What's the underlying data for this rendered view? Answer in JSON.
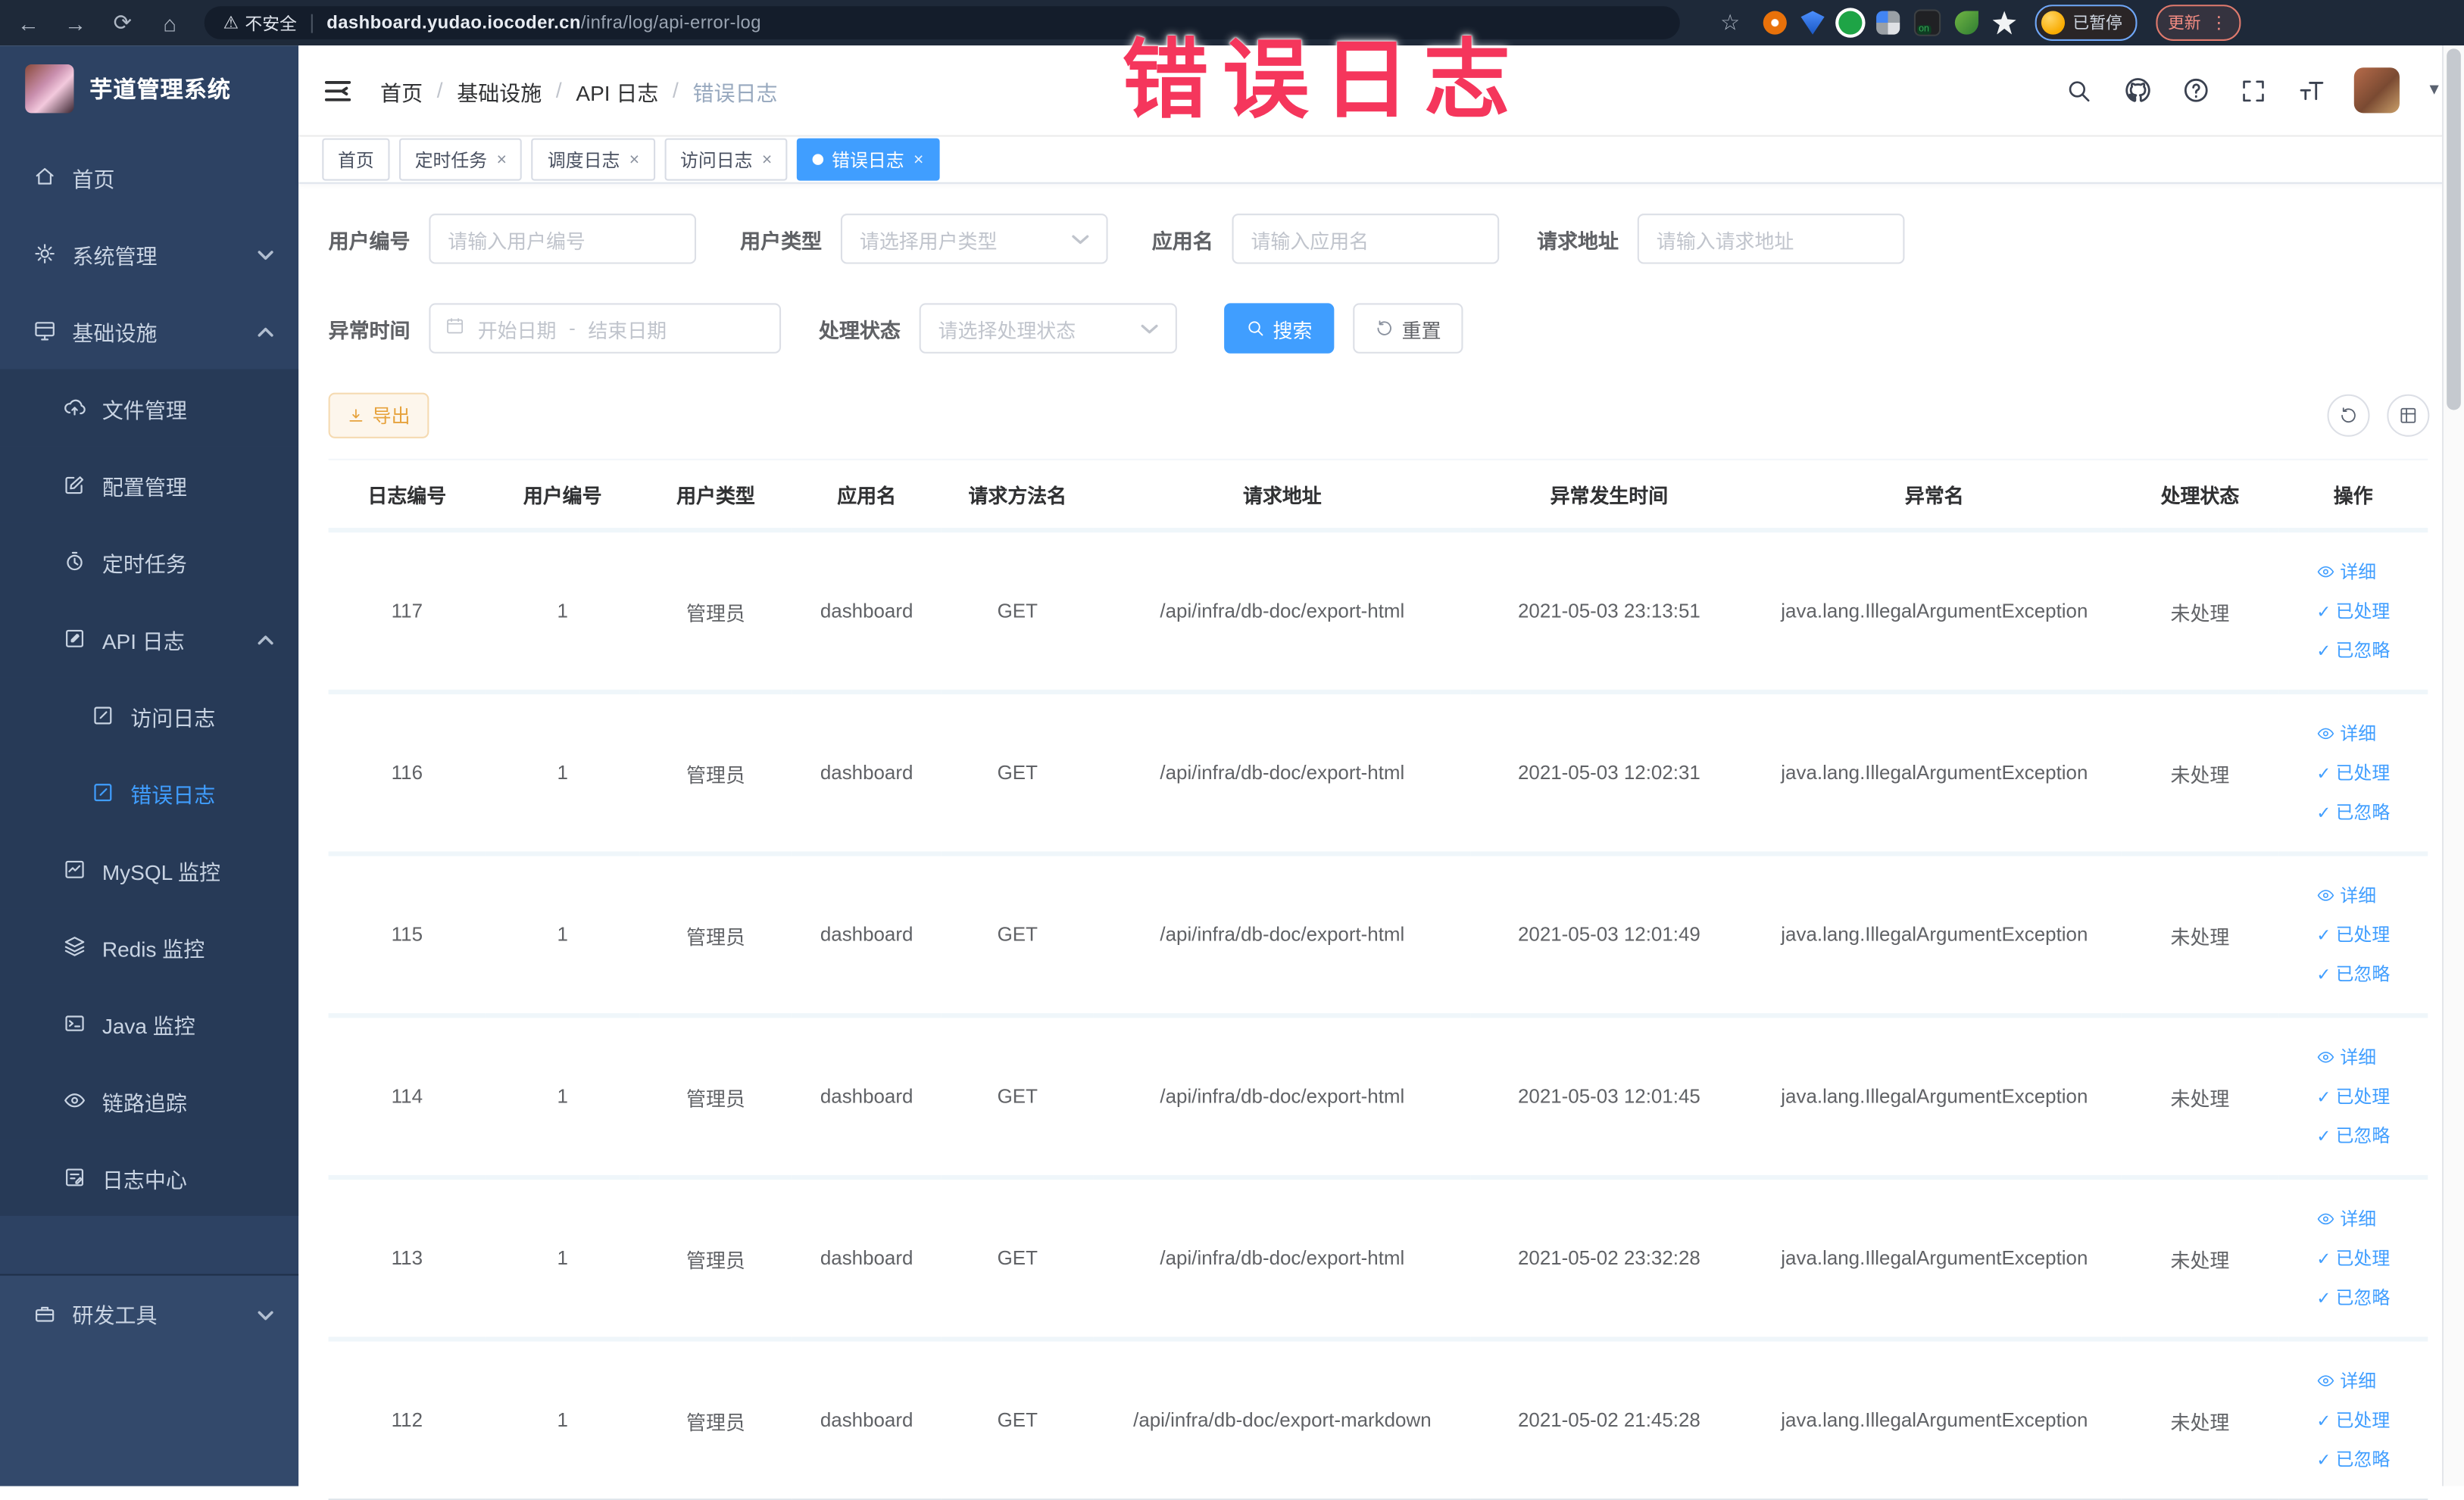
{
  "browser": {
    "security_label": "不安全",
    "url_host": "dashboard.yudao.iocoder.cn",
    "url_path": "/infra/log/api-error-log",
    "profile_badge": "已暂停",
    "update_button": "更新"
  },
  "annotation": {
    "text": "错误日志",
    "color": "#f5365c"
  },
  "sidebar": {
    "title": "芋道管理系统",
    "items": [
      {
        "label": "首页"
      },
      {
        "label": "系统管理"
      },
      {
        "label": "基础设施"
      },
      {
        "label": "文件管理"
      },
      {
        "label": "配置管理"
      },
      {
        "label": "定时任务"
      },
      {
        "label": "API 日志"
      },
      {
        "label": "访问日志"
      },
      {
        "label": "错误日志"
      },
      {
        "label": "MySQL 监控"
      },
      {
        "label": "Redis 监控"
      },
      {
        "label": "Java 监控"
      },
      {
        "label": "链路追踪"
      },
      {
        "label": "日志中心"
      },
      {
        "label": "研发工具"
      }
    ]
  },
  "header": {
    "breadcrumb": [
      "首页",
      "基础设施",
      "API 日志",
      "错误日志"
    ]
  },
  "tabs": [
    {
      "label": "首页"
    },
    {
      "label": "定时任务"
    },
    {
      "label": "调度日志"
    },
    {
      "label": "访问日志"
    },
    {
      "label": "错误日志"
    }
  ],
  "filters": {
    "user_id": {
      "label": "用户编号",
      "placeholder": "请输入用户编号"
    },
    "user_type": {
      "label": "用户类型",
      "placeholder": "请选择用户类型"
    },
    "app_name": {
      "label": "应用名",
      "placeholder": "请输入应用名"
    },
    "request_url": {
      "label": "请求地址",
      "placeholder": "请输入请求地址"
    },
    "exception_time": {
      "label": "异常时间",
      "start_placeholder": "开始日期",
      "separator": "-",
      "end_placeholder": "结束日期"
    },
    "process_status": {
      "label": "处理状态",
      "placeholder": "请选择处理状态"
    },
    "search_button": "搜索",
    "reset_button": "重置"
  },
  "toolbar": {
    "export_button": "导出"
  },
  "table": {
    "columns": [
      "日志编号",
      "用户编号",
      "用户类型",
      "应用名",
      "请求方法名",
      "请求地址",
      "异常发生时间",
      "异常名",
      "处理状态",
      "操作"
    ],
    "actions": {
      "detail": "详细",
      "processed": "已处理",
      "ignored": "已忽略"
    },
    "rows": [
      {
        "id": "117",
        "user_id": "1",
        "user_type": "管理员",
        "app": "dashboard",
        "method": "GET",
        "url": "/api/infra/db-doc/export-html",
        "time": "2021-05-03 23:13:51",
        "exception": "java.lang.IllegalArgumentException",
        "status": "未处理"
      },
      {
        "id": "116",
        "user_id": "1",
        "user_type": "管理员",
        "app": "dashboard",
        "method": "GET",
        "url": "/api/infra/db-doc/export-html",
        "time": "2021-05-03 12:02:31",
        "exception": "java.lang.IllegalArgumentException",
        "status": "未处理"
      },
      {
        "id": "115",
        "user_id": "1",
        "user_type": "管理员",
        "app": "dashboard",
        "method": "GET",
        "url": "/api/infra/db-doc/export-html",
        "time": "2021-05-03 12:01:49",
        "exception": "java.lang.IllegalArgumentException",
        "status": "未处理"
      },
      {
        "id": "114",
        "user_id": "1",
        "user_type": "管理员",
        "app": "dashboard",
        "method": "GET",
        "url": "/api/infra/db-doc/export-html",
        "time": "2021-05-03 12:01:45",
        "exception": "java.lang.IllegalArgumentException",
        "status": "未处理"
      },
      {
        "id": "113",
        "user_id": "1",
        "user_type": "管理员",
        "app": "dashboard",
        "method": "GET",
        "url": "/api/infra/db-doc/export-html",
        "time": "2021-05-02 23:32:28",
        "exception": "java.lang.IllegalArgumentException",
        "status": "未处理"
      },
      {
        "id": "112",
        "user_id": "1",
        "user_type": "管理员",
        "app": "dashboard",
        "method": "GET",
        "url": "/api/infra/db-doc/export-markdown",
        "time": "2021-05-02 21:45:28",
        "exception": "java.lang.IllegalArgumentException",
        "status": "未处理"
      }
    ]
  }
}
